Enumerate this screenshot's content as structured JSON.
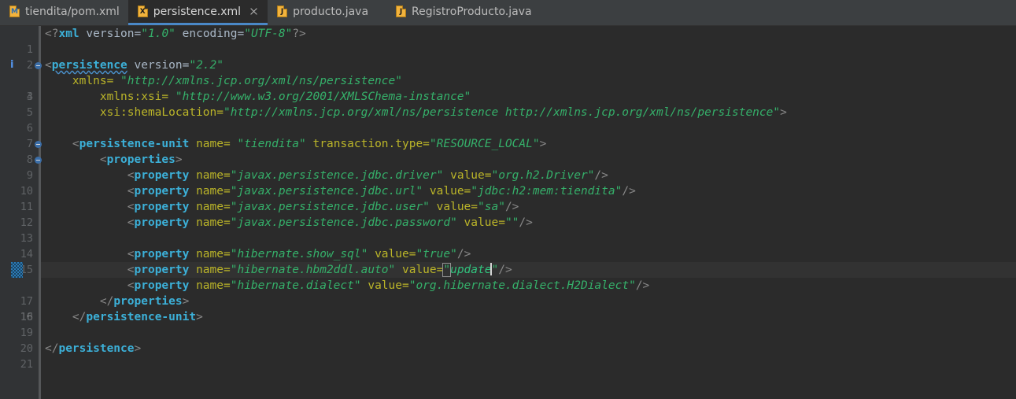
{
  "window": {
    "theme_background": "#2b2b2b",
    "gutter_background": "#313335",
    "tabbar_background": "#3c3f41",
    "accent": "#4a88c7"
  },
  "tabbar": {
    "tabs": [
      {
        "label": "tiendita/pom.xml",
        "icon": "maven-file-icon",
        "icon_letter": "M",
        "active": false,
        "closable": false
      },
      {
        "label": "persistence.xml",
        "icon": "xml-file-icon",
        "icon_letter": "X",
        "active": true,
        "closable": true
      },
      {
        "label": "producto.java",
        "icon": "java-file-icon",
        "icon_letter": "J",
        "active": false,
        "closable": false
      },
      {
        "label": "RegistroProducto.java",
        "icon": "java-file-icon",
        "icon_letter": "J",
        "active": false,
        "closable": false
      }
    ],
    "close_icon": "close-icon"
  },
  "editor": {
    "current_line": 16,
    "caret_after_text": "update",
    "lines": [
      {
        "n": "1",
        "indent": 0,
        "marker": null
      },
      {
        "n": "2",
        "indent": 0,
        "marker": null
      },
      {
        "n": "3",
        "indent": 0,
        "marker": "fold",
        "gutter_info": "i"
      },
      {
        "n": "4",
        "indent": 0,
        "marker": null
      },
      {
        "n": "5",
        "indent": 0,
        "marker": null
      },
      {
        "n": "6",
        "indent": 0,
        "marker": null
      },
      {
        "n": "7",
        "indent": 0,
        "marker": null
      },
      {
        "n": "8",
        "indent": 0,
        "marker": "fold"
      },
      {
        "n": "9",
        "indent": 0,
        "marker": "fold"
      },
      {
        "n": "10",
        "indent": 0,
        "marker": null
      },
      {
        "n": "11",
        "indent": 0,
        "marker": null
      },
      {
        "n": "12",
        "indent": 0,
        "marker": null
      },
      {
        "n": "13",
        "indent": 0,
        "marker": null
      },
      {
        "n": "14",
        "indent": 0,
        "marker": null
      },
      {
        "n": "15",
        "indent": 0,
        "marker": null
      },
      {
        "n": "16",
        "indent": 0,
        "marker": "changed"
      },
      {
        "n": "17",
        "indent": 0,
        "marker": null
      },
      {
        "n": "18",
        "indent": 0,
        "marker": null
      },
      {
        "n": "19",
        "indent": 0,
        "marker": null
      },
      {
        "n": "20",
        "indent": 0,
        "marker": null
      },
      {
        "n": "21",
        "indent": 0,
        "marker": null
      }
    ],
    "code_text": {
      "l1": "<?xml version=\"1.0\" encoding=\"UTF-8\"?>",
      "l2": "",
      "l3": "<persistence version=\"2.2\"",
      "l4": "    xmlns= \"http://xmlns.jcp.org/xml/ns/persistence\"",
      "l5": "        xmlns:xsi= \"http://www.w3.org/2001/XMLSChema-instance\"",
      "l6": "        xsi:shemaLocation=\"http://xmlns.jcp.org/xml/ns/persistence http://xmlns.jcp.org/xml/ns/persistence\">",
      "l7": "",
      "l8": "    <persistence-unit name= \"tiendita\" transaction.type=\"RESOURCE_LOCAL\">",
      "l9": "        <properties>",
      "l10": "            <property name=\"javax.persistence.jdbc.driver\" value=\"org.h2.Driver\"/>",
      "l11": "            <property name=\"javax.persistence.jdbc.url\" value=\"jdbc:h2:mem:tiendita\"/>",
      "l12": "            <property name=\"javax.persistence.jdbc.user\" value=\"sa\"/>",
      "l13": "            <property name=\"javax.persistence.jdbc.password\" value=\"\"/>",
      "l14": "",
      "l15": "            <property name=\"hibernate.show_sql\" value=\"true\"/>",
      "l16": "            <property name=\"hibernate.hbm2ddl.auto\" value=\"update\"/>",
      "l17": "            <property name=\"hibernate.dialect\" value=\"org.hibernate.dialect.H2Dialect\"/>",
      "l18": "        </properties>",
      "l19": "    </persistence-unit>",
      "l20": "",
      "l21": "</persistence>"
    }
  }
}
